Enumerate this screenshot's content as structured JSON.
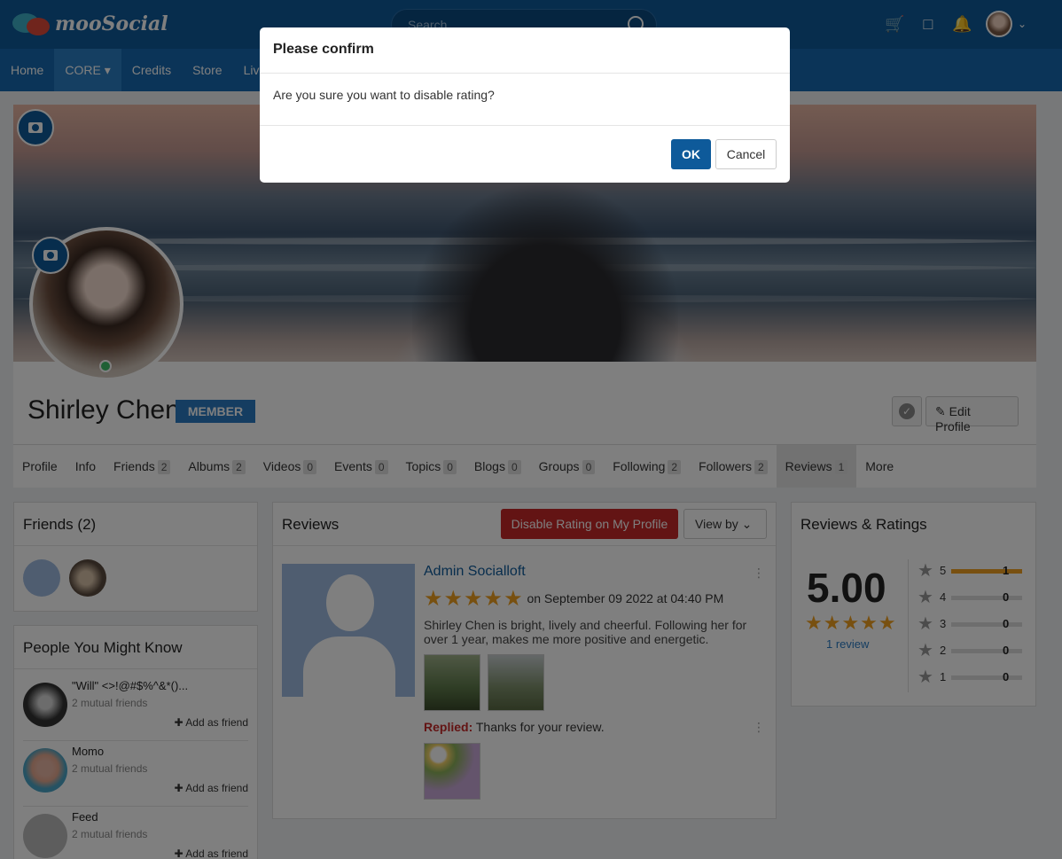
{
  "app": {
    "logo_text": "mooSocial"
  },
  "header": {
    "search_placeholder": "Search",
    "icons": [
      "cart-icon",
      "chat-icon",
      "bell-icon"
    ]
  },
  "nav": [
    "Home",
    "CORE",
    "Credits",
    "Store",
    "Live"
  ],
  "profile": {
    "name": "Shirley Chen",
    "role_badge": "MEMBER",
    "edit_label": "Edit Profile",
    "tabs": [
      {
        "label": "Profile",
        "count": ""
      },
      {
        "label": "Info",
        "count": ""
      },
      {
        "label": "Friends",
        "count": "2"
      },
      {
        "label": "Albums",
        "count": "2"
      },
      {
        "label": "Videos",
        "count": "0"
      },
      {
        "label": "Events",
        "count": "0"
      },
      {
        "label": "Topics",
        "count": "0"
      },
      {
        "label": "Blogs",
        "count": "0"
      },
      {
        "label": "Groups",
        "count": "0"
      },
      {
        "label": "Following",
        "count": "2"
      },
      {
        "label": "Followers",
        "count": "2"
      },
      {
        "label": "Reviews",
        "count": "1"
      },
      {
        "label": "More",
        "count": ""
      }
    ]
  },
  "friends_panel": {
    "title": "Friends (2)"
  },
  "pymk": {
    "title": "People You Might Know",
    "add_label": "Add as friend",
    "items": [
      {
        "name": "\"Will\" <>!@#$%^&*()...",
        "mutual": "2 mutual friends"
      },
      {
        "name": "Momo",
        "mutual": "2 mutual friends"
      },
      {
        "name": "Feed",
        "mutual": "2 mutual friends"
      }
    ]
  },
  "reviews": {
    "title": "Reviews",
    "disable_label": "Disable Rating on My Profile",
    "viewby_label": "View by",
    "item": {
      "author": "Admin Socialloft",
      "rating": 5,
      "date": "on September 09 2022 at 04:40 PM",
      "text": "Shirley Chen is bright, lively and cheerful. Following her for over 1 year, makes me more positive and energetic.",
      "replied_label": "Replied:",
      "reply": "Thanks for your review."
    }
  },
  "ratings": {
    "title": "Reviews & Ratings",
    "average": "5.00",
    "count_label": "1 review",
    "rows": [
      {
        "star": "5",
        "count": "1",
        "fraction": 1
      },
      {
        "star": "4",
        "count": "0",
        "fraction": 0
      },
      {
        "star": "3",
        "count": "0",
        "fraction": 0
      },
      {
        "star": "2",
        "count": "0",
        "fraction": 0
      },
      {
        "star": "1",
        "count": "0",
        "fraction": 0
      }
    ]
  },
  "modal": {
    "title": "Please confirm",
    "message": "Are you sure you want to disable rating?",
    "ok_label": "OK",
    "cancel_label": "Cancel"
  },
  "colors": {
    "header": "#0e5a9a",
    "nav": "#1769b0",
    "danger": "#c62828",
    "star": "#f0a020"
  }
}
